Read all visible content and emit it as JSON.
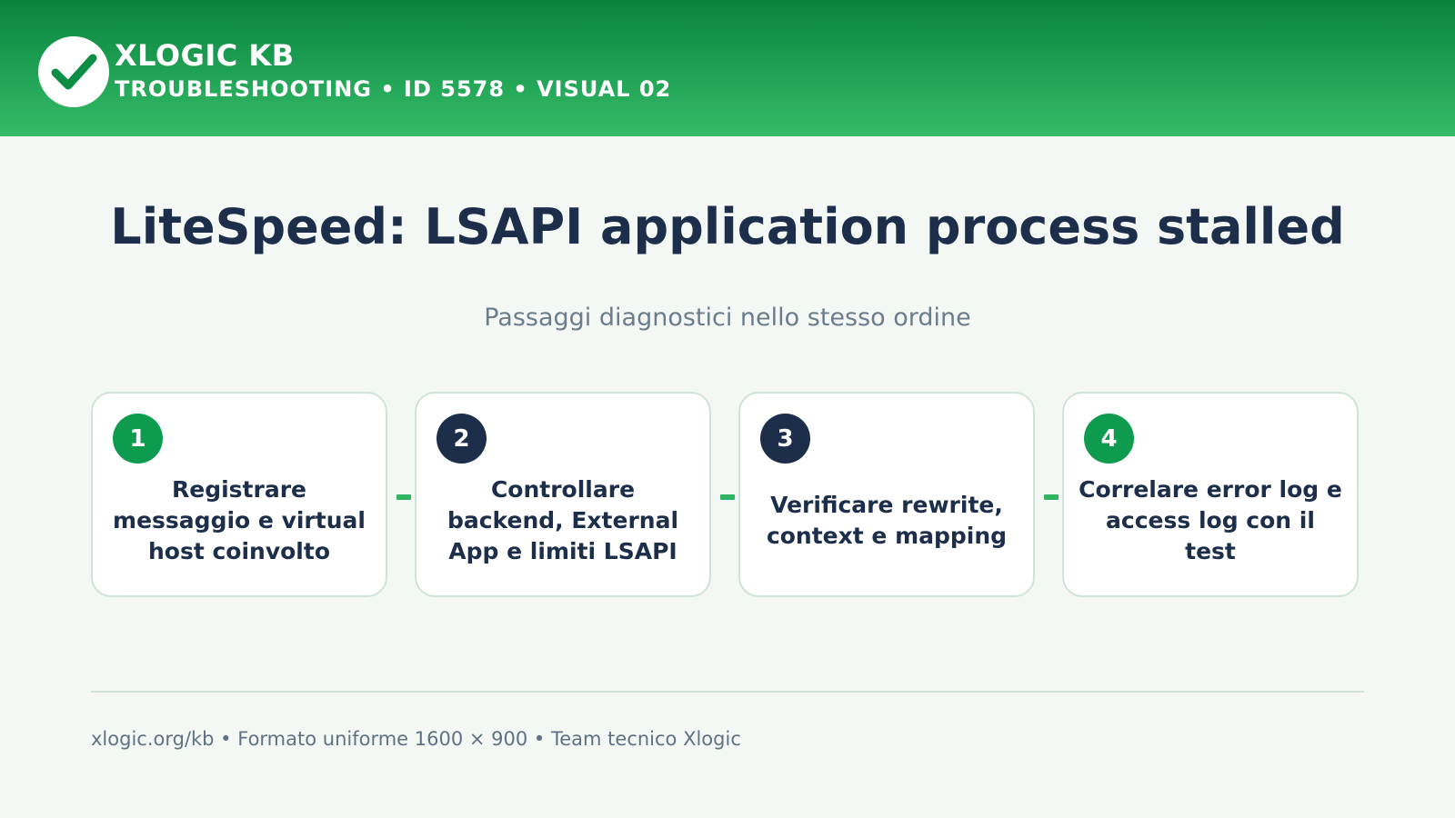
{
  "header": {
    "brand": "XLOGIC KB",
    "subtitle": "TROUBLESHOOTING • ID 5578 • VISUAL 02",
    "logo_icon": "checkmark-icon"
  },
  "main": {
    "title": "LiteSpeed: LSAPI application process stalled",
    "lead": "Passaggi diagnostici nello stesso ordine",
    "steps": [
      {
        "number": "1",
        "text": "Registrare messaggio e virtual host coinvolto",
        "badge_color": "#0e9b4f"
      },
      {
        "number": "2",
        "text": "Controllare backend, External App e limiti LSAPI",
        "badge_color": "#1c2e4a"
      },
      {
        "number": "3",
        "text": "Verificare rewrite, context e mapping",
        "badge_color": "#1c2e4a"
      },
      {
        "number": "4",
        "text": "Correlare error log e access log con il test",
        "badge_color": "#0e9b4f"
      }
    ]
  },
  "footer": {
    "text": "xlogic.org/kb • Formato uniforme 1600 × 900 • Team tecnico Xlogic"
  },
  "colors": {
    "accent_green": "#0e9b4f",
    "navy": "#1c2e4a",
    "background": "#f4f8f5"
  }
}
